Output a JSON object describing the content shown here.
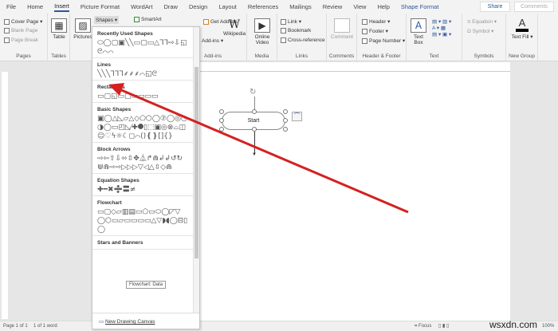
{
  "tabs": [
    "File",
    "Home",
    "Insert",
    "Picture Format",
    "WordArt",
    "Draw",
    "Design",
    "Layout",
    "References",
    "Mailings",
    "Review",
    "View",
    "Help",
    "Shape Format"
  ],
  "share": "Share",
  "comments": "Comments",
  "ribbon": {
    "pages": {
      "cover": "Cover Page",
      "blank": "Blank Page",
      "break": "Page Break",
      "label": "Pages"
    },
    "tables": {
      "table": "Table",
      "label": "Tables"
    },
    "illus": {
      "pictures": "Pictures",
      "shapes": "Shapes",
      "smartart": "SmartArt"
    },
    "addins": {
      "get": "Get Add-ins",
      "my": "Add-ins",
      "wiki": "Wikipedia",
      "label": "Add-ins"
    },
    "media": {
      "video": "Online Video",
      "label": "Media"
    },
    "links": {
      "link": "Link",
      "bookmark": "Bookmark",
      "xref": "Cross-reference",
      "label": "Links"
    },
    "comments": {
      "comment": "Comment",
      "label": "Comments"
    },
    "hf": {
      "header": "Header",
      "footer": "Footer",
      "pagenum": "Page Number",
      "label": "Header & Footer"
    },
    "text": {
      "textbox": "Text Box",
      "label": "Text"
    },
    "symbols": {
      "equation": "Equation",
      "symbol": "Symbol",
      "label": "Symbols"
    },
    "newgroup": {
      "textfill": "Text Fill",
      "label": "New Group"
    }
  },
  "panel": {
    "sections": [
      {
        "title": "Recently Used Shapes",
        "shapes": "⬭◯▢▣╲╲▭▢▭△ᒣᒣ⇨⇩◱ᘓ⌒⌒"
      },
      {
        "title": "Lines",
        "shapes": "╲╲╲ᒣᒣᒣ⸙⸙⸙⌒◱ᘓ"
      },
      {
        "title": "Rectangles",
        "shapes": "▭▢◱▭▢▭▭▭▭"
      },
      {
        "title": "Basic Shapes",
        "shapes": "▣◯△◺▱△◇⬠⬡◯⑦◯◎◔◑◯▭◰◺⁄✚⯃▯⬚▣◎⊗⌓◫☺♡ϟ☼☾◻⌒()❴❵[]{}"
      },
      {
        "title": "Block Arrows",
        "shapes": "⇨⇦⇧⇩⬄⇳✥⏅↱⋒↲↲↺↻⋓⋒⇨⇨▷▷▷▽◁△⇳◇⋒"
      },
      {
        "title": "Equation Shapes",
        "shapes": "✚━✖➗〓≠"
      },
      {
        "title": "Flowchart",
        "shapes": "▭▢◇▱▥▤▭⬠▭⬭◯◸▽◯⬡▭▱▭▭▭▭△▽◗◖◯⊟▯◯"
      },
      {
        "title": "Stars and Banners",
        "shapes": ""
      }
    ],
    "tooltip": "Flowchart: Data",
    "canvas": "New Drawing Canvas"
  },
  "doc": {
    "shape_text": "Start"
  },
  "status": {
    "page": "Page 1 of 1",
    "words": "1 of 1 word",
    "focus": "Focus",
    "zoom": "100%"
  },
  "watermark": "wsxdn.com",
  "colors": {
    "accent": "#2b579a",
    "arrow": "#d42020"
  }
}
